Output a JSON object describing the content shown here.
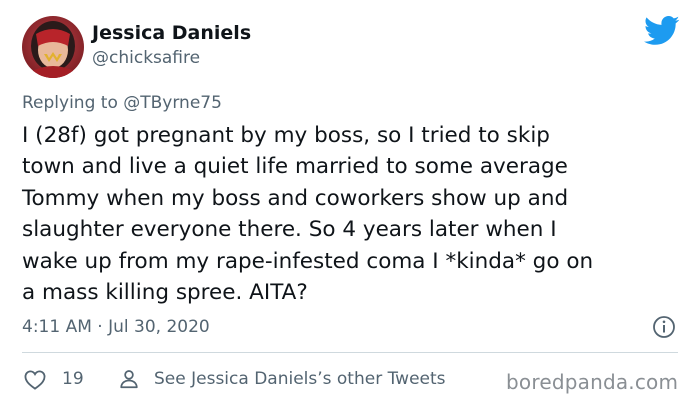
{
  "author": {
    "display_name": "Jessica Daniels",
    "handle": "@chicksafire",
    "avatar_icon": "wonder-woman-avatar"
  },
  "platform_icon": "twitter-bird-icon",
  "reply": {
    "prefix": "Replying to ",
    "handle": "@TByrne75"
  },
  "tweet": {
    "lines": [
      "I (28f) got pregnant by my boss, so I tried to skip",
      "town and live a quiet life married to some average",
      "Tommy when my boss and coworkers show up and",
      "slaughter everyone there. So 4 years later when I",
      "wake up from my rape-infested coma I *kinda* go on",
      "a mass killing spree. AITA?"
    ]
  },
  "timestamp": "4:11 AM · Jul 30, 2020",
  "footer": {
    "like_count": "19",
    "other_tweets_label": "See Jessica Daniels’s other Tweets"
  },
  "watermark": "boredpanda.com",
  "colors": {
    "text": "#0f1419",
    "secondary": "#536471",
    "twitter_blue": "#1d9bf0",
    "divider": "#cfd9de"
  }
}
